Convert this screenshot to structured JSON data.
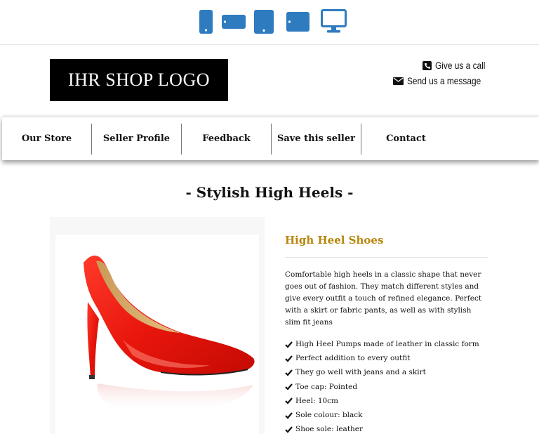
{
  "device_bar": {
    "buttons": [
      {
        "name": "phone-portrait",
        "icon": "phone-portrait-icon"
      },
      {
        "name": "phone-landscape",
        "icon": "phone-landscape-icon"
      },
      {
        "name": "tablet-portrait",
        "icon": "tablet-portrait-icon"
      },
      {
        "name": "tablet-landscape",
        "icon": "tablet-landscape-icon"
      },
      {
        "name": "desktop",
        "icon": "desktop-icon"
      }
    ],
    "accent_color": "#2f7bbf"
  },
  "header": {
    "logo_text": "IHR SHOP LOGO",
    "call_label": "Give us a call",
    "message_label": "Send us a message"
  },
  "nav": {
    "items": [
      {
        "label": "Our Store"
      },
      {
        "label": "Seller Profile"
      },
      {
        "label": "Feedback"
      },
      {
        "label": "Save this seller"
      },
      {
        "label": "Contact"
      }
    ]
  },
  "main": {
    "page_title": "- Stylish High Heels -",
    "product": {
      "title": "High Heel Shoes",
      "title_color": "#b8860b",
      "description": "Comfortable high heels in a classic shape that never goes out of fashion. They match different styles and give every outfit a touch of refined elegance. Perfect with a skirt or fabric pants, as well as with stylish slim fit jeans",
      "features": [
        "High Heel Pumps made of leather in classic form",
        "Perfect addition to every outfit",
        "They go well with jeans and a skirt",
        "Toe cap: Pointed",
        "Heel: 10cm",
        "Sole colour: black",
        "Shoe sole: leather"
      ]
    }
  }
}
